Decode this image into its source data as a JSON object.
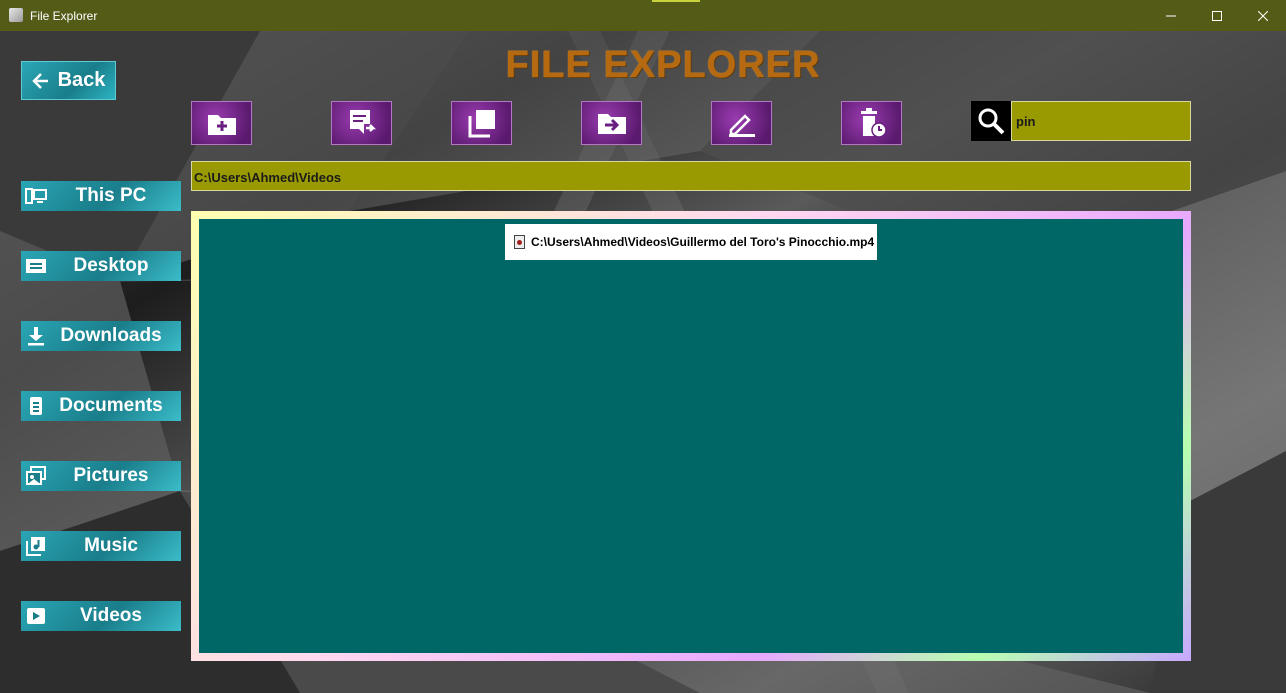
{
  "window": {
    "title": "File Explorer"
  },
  "logo": {
    "text": "FILE EXPLORER"
  },
  "back_button": {
    "label": "Back"
  },
  "toolbar": {
    "buttons": [
      {
        "icon": "new-folder-icon"
      },
      {
        "icon": "move-file-icon"
      },
      {
        "icon": "copy-icon"
      },
      {
        "icon": "move-to-folder-icon"
      },
      {
        "icon": "rename-icon"
      },
      {
        "icon": "delete-icon"
      }
    ]
  },
  "search": {
    "value": "pin"
  },
  "path_bar": {
    "path": "C:\\Users\\Ahmed\\Videos"
  },
  "sidebar": {
    "items": [
      {
        "label": "This PC",
        "icon": "computer-icon"
      },
      {
        "label": "Desktop",
        "icon": "desktop-icon"
      },
      {
        "label": "Downloads",
        "icon": "download-icon"
      },
      {
        "label": "Documents",
        "icon": "document-icon"
      },
      {
        "label": "Pictures",
        "icon": "pictures-icon"
      },
      {
        "label": "Music",
        "icon": "music-icon"
      },
      {
        "label": "Videos",
        "icon": "video-icon"
      }
    ]
  },
  "files": [
    {
      "name": "C:\\Users\\Ahmed\\Videos\\Guillermo del Toro's Pinocchio.mp4",
      "icon": "video-file-icon"
    }
  ],
  "colors": {
    "titlebar": "#545b17",
    "input_bg": "#999900",
    "pane_bg": "#006666",
    "sidebar_button": "#1a7d8a",
    "toolbar_button": "#5a1a6e",
    "logo": "#b56a12"
  }
}
